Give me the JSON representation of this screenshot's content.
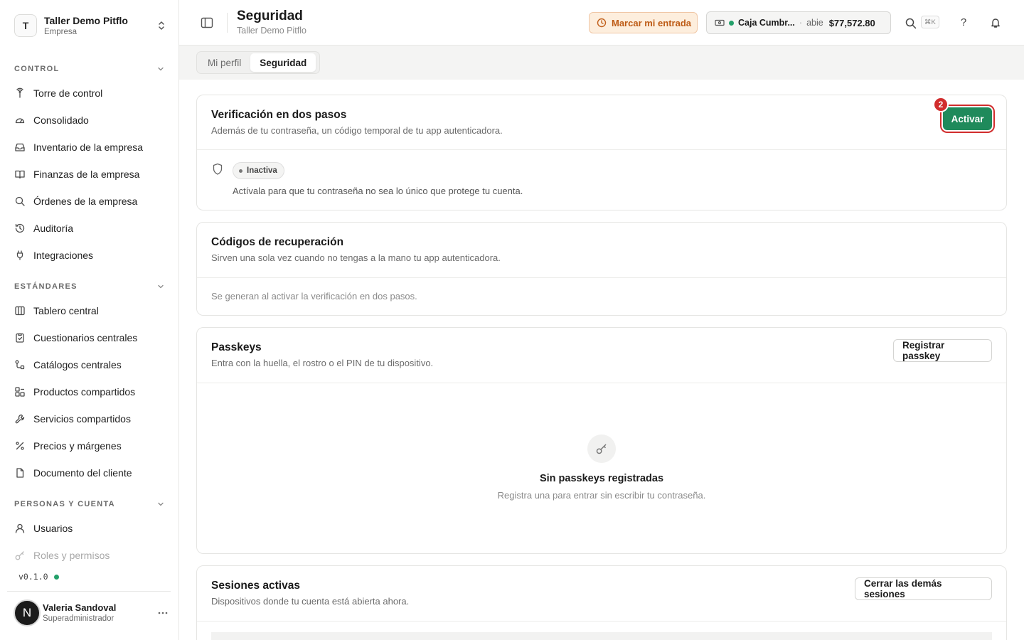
{
  "workspace": {
    "initial": "T",
    "name": "Taller Demo Pitflo",
    "type": "Empresa"
  },
  "sidebar": {
    "sections": [
      {
        "label": "CONTROL"
      },
      {
        "label": "ESTÁNDARES"
      },
      {
        "label": "PERSONAS Y CUENTA"
      }
    ],
    "items": [
      {
        "label": "Torre de control",
        "icon": "tower-icon"
      },
      {
        "label": "Consolidado",
        "icon": "gauge-icon"
      },
      {
        "label": "Inventario de la empresa",
        "icon": "inbox-icon"
      },
      {
        "label": "Finanzas de la empresa",
        "icon": "book-icon"
      },
      {
        "label": "Órdenes de la empresa",
        "icon": "search-icon"
      },
      {
        "label": "Auditoría",
        "icon": "history-icon"
      },
      {
        "label": "Integraciones",
        "icon": "plug-icon"
      },
      {
        "label": "Tablero central",
        "icon": "board-icon"
      },
      {
        "label": "Cuestionarios centrales",
        "icon": "clipboard-icon"
      },
      {
        "label": "Catálogos centrales",
        "icon": "catalog-icon"
      },
      {
        "label": "Productos compartidos",
        "icon": "products-icon"
      },
      {
        "label": "Servicios compartidos",
        "icon": "wrench-icon"
      },
      {
        "label": "Precios y márgenes",
        "icon": "percent-icon"
      },
      {
        "label": "Documento del cliente",
        "icon": "document-icon"
      },
      {
        "label": "Usuarios",
        "icon": "user-icon"
      },
      {
        "label": "Roles y permisos",
        "icon": "key-icon"
      }
    ],
    "version": "v0.1.0"
  },
  "user": {
    "initial": "N",
    "name": "Valeria Sandoval",
    "role": "Superadministrador"
  },
  "header": {
    "title": "Seguridad",
    "subtitle": "Taller Demo Pitflo",
    "clock_in_label": "Marcar mi entrada",
    "register": {
      "name": "Caja Cumbr...",
      "separator": "·",
      "status": "abie",
      "amount": "$77,572.80"
    },
    "shortcut": "⌘K",
    "help": "?"
  },
  "tabs": [
    {
      "label": "Mi perfil",
      "active": false
    },
    {
      "label": "Seguridad",
      "active": true
    }
  ],
  "two_factor": {
    "title": "Verificación en dos pasos",
    "description": "Además de tu contraseña, un código temporal de tu app autenticadora.",
    "button": "Activar",
    "marker": "2",
    "status": "Inactiva",
    "note": "Actívala para que tu contraseña no sea lo único que protege tu cuenta."
  },
  "recovery": {
    "title": "Códigos de recuperación",
    "description": "Sirven una sola vez cuando no tengas a la mano tu app autenticadora.",
    "note": "Se generan al activar la verificación en dos pasos."
  },
  "passkeys": {
    "title": "Passkeys",
    "description": "Entra con la huella, el rostro o el PIN de tu dispositivo.",
    "button": "Registrar passkey",
    "empty_title": "Sin passkeys registradas",
    "empty_desc": "Registra una para entrar sin escribir tu contraseña."
  },
  "sessions": {
    "title": "Sesiones activas",
    "description": "Dispositivos donde tu cuenta está abierta ahora.",
    "button": "Cerrar las demás sesiones"
  },
  "colors": {
    "primary": "#1f8a5b",
    "highlight": "#d12d2d",
    "clock_in": "#bd5a14",
    "online": "#23a06a"
  }
}
